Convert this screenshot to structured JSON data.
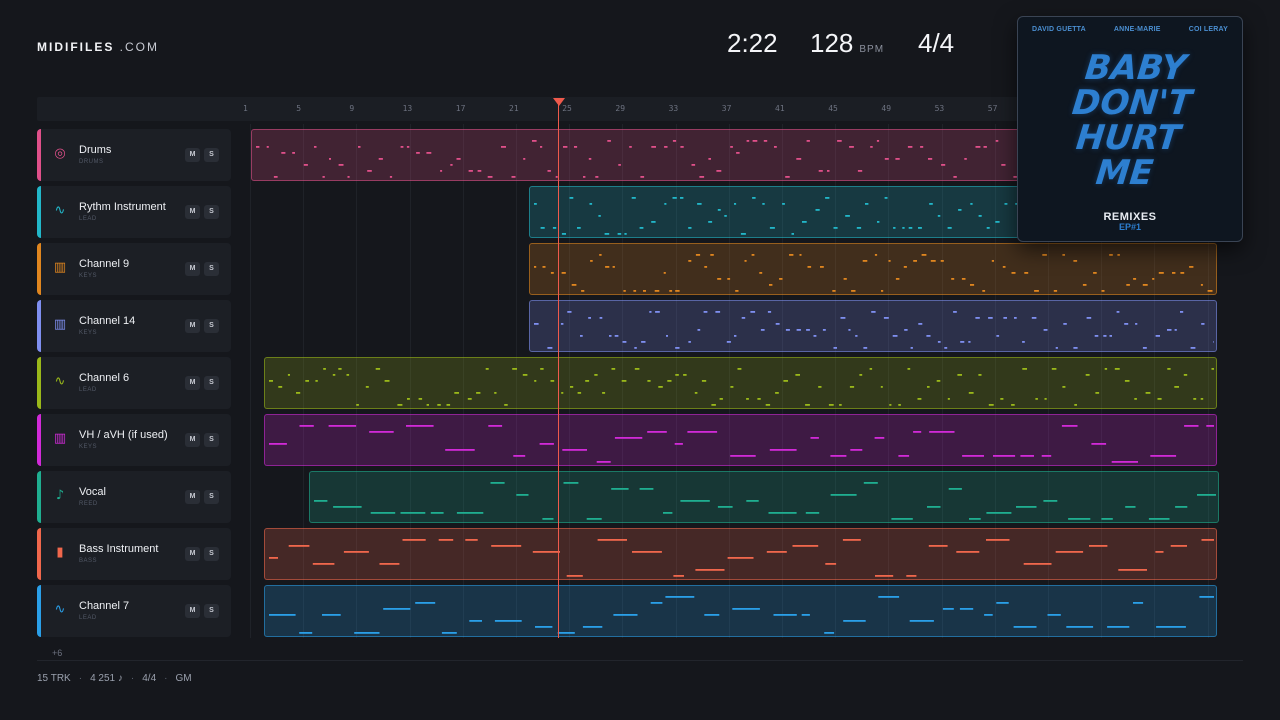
{
  "brand": {
    "name_bold": "MIDIFILES",
    "name_rest": " .COM"
  },
  "transport": {
    "time": "2:22",
    "bpm": "128",
    "bpm_unit": "BPM",
    "signature": "4/4"
  },
  "ruler": {
    "bars": [
      "1",
      "5",
      "9",
      "13",
      "17",
      "21",
      "25",
      "29",
      "33",
      "37",
      "41",
      "45",
      "49",
      "53",
      "57"
    ]
  },
  "tracks": [
    {
      "name": "Drums",
      "category": "DRUMS",
      "color": "#e0508a",
      "icon": "drum-icon",
      "glyph": "◎",
      "mute": "M",
      "solo": "S"
    },
    {
      "name": "Rythm Instrument",
      "category": "LEAD",
      "color": "#22b7c9",
      "icon": "waveform-icon",
      "glyph": "∿",
      "mute": "M",
      "solo": "S"
    },
    {
      "name": "Channel 9",
      "category": "KEYS",
      "color": "#e0861f",
      "icon": "keyboard-icon",
      "glyph": "▥",
      "mute": "M",
      "solo": "S"
    },
    {
      "name": "Channel 14",
      "category": "KEYS",
      "color": "#7f8ff0",
      "icon": "keyboard-icon",
      "glyph": "▥",
      "mute": "M",
      "solo": "S"
    },
    {
      "name": "Channel 6",
      "category": "LEAD",
      "color": "#9ab81a",
      "icon": "waveform-icon",
      "glyph": "∿",
      "mute": "M",
      "solo": "S"
    },
    {
      "name": "VH / aVH (if used)",
      "category": "KEYS",
      "color": "#d12ad8",
      "icon": "keyboard-icon",
      "glyph": "▥",
      "mute": "M",
      "solo": "S"
    },
    {
      "name": "Vocal",
      "category": "REED",
      "color": "#1fae90",
      "icon": "saxophone-icon",
      "glyph": "♪",
      "mute": "M",
      "solo": "S"
    },
    {
      "name": "Bass Instrument",
      "category": "BASS",
      "color": "#f0674c",
      "icon": "amp-icon",
      "glyph": "▮",
      "mute": "M",
      "solo": "S"
    },
    {
      "name": "Channel 7",
      "category": "LEAD",
      "color": "#2a9fe8",
      "icon": "waveform-icon",
      "glyph": "∿",
      "mute": "M",
      "solo": "S"
    }
  ],
  "more_tracks": "+6",
  "footer": {
    "tracks": "15 TRK",
    "notes": "4 251 ♪",
    "signature": "4/4",
    "standard": "GM"
  },
  "album": {
    "artists": [
      "DAVID GUETTA",
      "ANNE-MARIE",
      "COI LERAY"
    ],
    "title_lines": [
      "BABY",
      "DON'T",
      "HURT",
      "ME"
    ],
    "remix_label": "REMIXES",
    "ep_label": "EP#1"
  }
}
